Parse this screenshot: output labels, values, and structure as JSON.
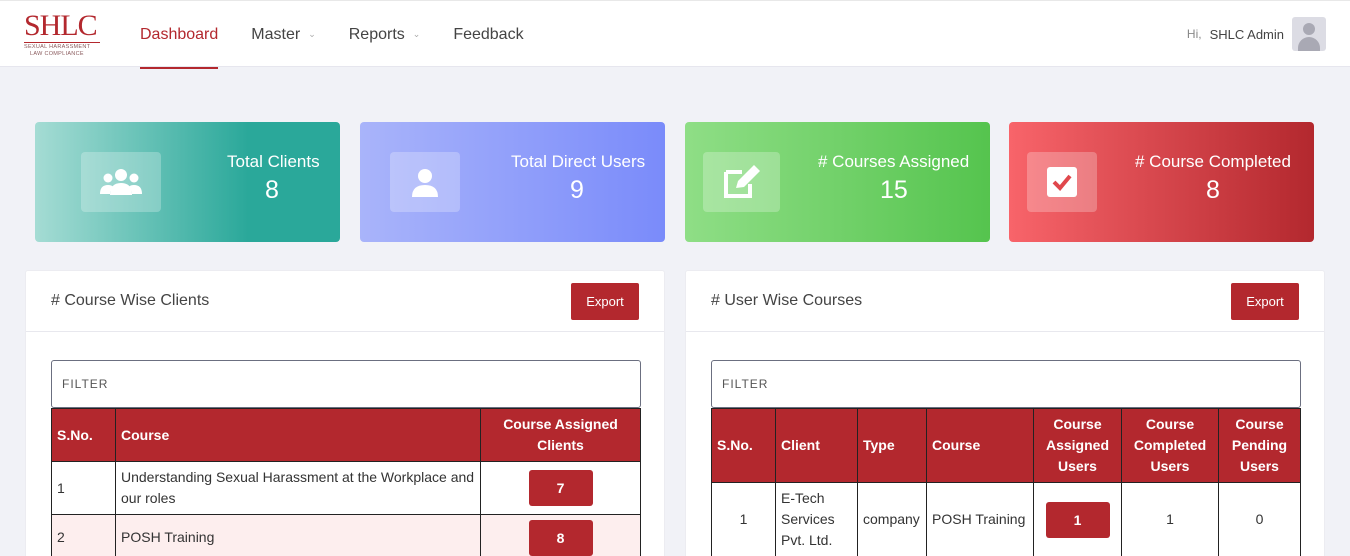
{
  "brand": {
    "logo_text": "SHLC",
    "logo_sub1": "SEXUAL HARASSMENT",
    "logo_sub2": "LAW COMPLIANCE"
  },
  "nav": {
    "items": [
      {
        "label": "Dashboard",
        "active": true,
        "dropdown": false
      },
      {
        "label": "Master",
        "active": false,
        "dropdown": true
      },
      {
        "label": "Reports",
        "active": false,
        "dropdown": true
      },
      {
        "label": "Feedback",
        "active": false,
        "dropdown": false
      }
    ]
  },
  "user": {
    "greeting": "Hi,",
    "name": "SHLC Admin"
  },
  "stats": [
    {
      "label": "Total Clients",
      "value": "8",
      "icon": "users-icon"
    },
    {
      "label": "Total Direct Users",
      "value": "9",
      "icon": "user-icon"
    },
    {
      "label": "# Courses Assigned",
      "value": "15",
      "icon": "edit-icon"
    },
    {
      "label": "# Course Completed",
      "value": "8",
      "icon": "check-square-icon"
    }
  ],
  "course_wise": {
    "title": "# Course Wise Clients",
    "export_label": "Export",
    "filter_placeholder": "FILTER",
    "columns": [
      "S.No.",
      "Course",
      "Course Assigned Clients"
    ],
    "rows": [
      {
        "sno": "1",
        "course": "Understanding Sexual Harassment at the Workplace and our roles",
        "count": "7"
      },
      {
        "sno": "2",
        "course": "POSH Training",
        "count": "8"
      }
    ]
  },
  "user_wise": {
    "title": "# User Wise Courses",
    "export_label": "Export",
    "filter_placeholder": "FILTER",
    "columns": [
      "S.No.",
      "Client",
      "Type",
      "Course",
      "Course Assigned Users",
      "Course Completed Users",
      "Course Pending Users"
    ],
    "rows": [
      {
        "sno": "1",
        "client": "E-Tech Services Pvt. Ltd.",
        "type": "company",
        "course": "POSH Training",
        "assigned": "1",
        "completed": "1",
        "pending": "0"
      }
    ]
  },
  "colors": {
    "brand_red": "#b3282e",
    "page_bg": "#f1f2f7"
  }
}
